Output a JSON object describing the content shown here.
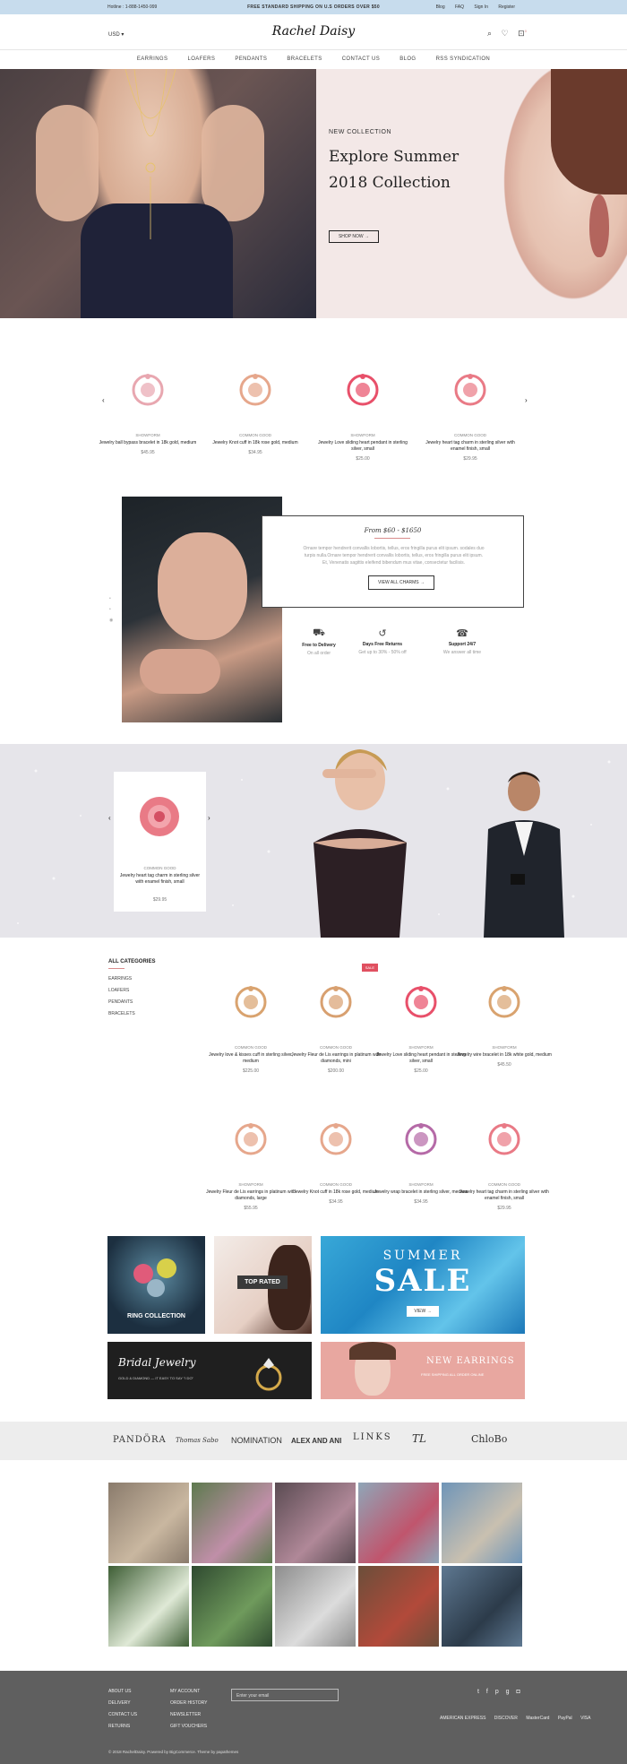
{
  "topbar": {
    "hotline": "Hotline : 1-888-1450-999",
    "shipping": "FREE STANDARD SHIPPING ON U.S ORDERS OVER $50",
    "links": [
      "Blog",
      "FAQ",
      "Sign In",
      "Register"
    ]
  },
  "header": {
    "currency": "USD ▾",
    "logo": "Rachel Daisy",
    "cart_count": "0"
  },
  "nav": [
    "EARRINGS",
    "LOAFERS",
    "PENDANTS",
    "BRACELETS",
    "CONTACT US",
    "BLOG",
    "RSS SYNDICATION"
  ],
  "hero": {
    "tag": "NEW COLLECTION",
    "title": "Explore Summer 2018 Collection",
    "button": "SHOP NOW →"
  },
  "carousel": [
    {
      "cat": "SHOWFORM",
      "name": "Jewelry ball bypass bracelet in 18k gold, medium",
      "price": "$45.95",
      "color": "#e8a7b0"
    },
    {
      "cat": "COMMON GOOD",
      "name": "Jewelry Knot cuff in 18k rose gold, medium",
      "price": "$34.95",
      "color": "#e6a78c"
    },
    {
      "cat": "SHOWFORM",
      "name": "Jewelry Love sliding heart pendant in sterling silver, small",
      "price": "$25.00",
      "color": "#e8506a"
    },
    {
      "cat": "COMMON GOOD",
      "name": "Jewelry heart tag charm in sterling silver with enamel finish, small",
      "price": "$29.95",
      "color": "#e97a86"
    }
  ],
  "feature": {
    "price": "From $60 - $1650",
    "desc": "Ornare tempor hendrerit convallis lobortis, tellus, eros fringilla purus elit ipsum. sodales duo turpis nulla.Ornare tempor hendrerit convallis lobortis, tellus, eros fringilla purus elit ipsum. Et, Venenatis sagittis eleifend bibendum mus vitae, consectetur facilisis.",
    "button": "VIEW ALL CHARMS →"
  },
  "perks": [
    {
      "icon": "truck-icon",
      "glyph": "⛟",
      "title": "Free to Delivery",
      "sub": "On all order"
    },
    {
      "icon": "returns-icon",
      "glyph": "↺",
      "title": "Days Free Returns",
      "sub": "Get up to 30% - 50% off"
    },
    {
      "icon": "support-icon",
      "glyph": "☎",
      "title": "Support 24/7",
      "sub": "We answer all time"
    }
  ],
  "promo_card": {
    "cat": "COMMON GOOD",
    "name": "Jewelry heart tag charm in sterling silver with enamel finish, small",
    "price": "$29.95"
  },
  "sidebar": {
    "title": "ALL CATEGORIES",
    "items": [
      "EARRINGS",
      "LOAFERS",
      "PENDANTS",
      "BRACELETS"
    ]
  },
  "grid": [
    {
      "cat": "COMMON GOOD",
      "name": "Jewelry love & kisses cuff in sterling silver, medium",
      "price": "$225.00",
      "color": "#d9a36f",
      "badge": ""
    },
    {
      "cat": "COMMON GOOD",
      "name": "Jewelry Fleur de Lis earrings in platinum with diamonds, mini",
      "price": "$200.00",
      "color": "#d8a070",
      "badge": "SALE"
    },
    {
      "cat": "SHOWFORM",
      "name": "Jewelry Love sliding heart pendant in sterling silver, small",
      "price": "$25.00",
      "color": "#e8506a",
      "badge": ""
    },
    {
      "cat": "SHOWFORM",
      "name": "Jewelry wire bracelet in 18k white gold, medium",
      "price": "$45.50",
      "color": "#d9a36f",
      "badge": ""
    },
    {
      "cat": "SHOWFORM",
      "name": "Jewelry Fleur de Lis earrings in platinum with diamonds, large",
      "price": "$55.95",
      "color": "#e6a78c",
      "badge": ""
    },
    {
      "cat": "COMMON GOOD",
      "name": "Jewelry Knot cuff in 18k rose gold, medium",
      "price": "$34.95",
      "color": "#e6a78c",
      "badge": ""
    },
    {
      "cat": "SHOWFORM",
      "name": "Jewelry wrap bracelet in sterling silver, medium",
      "price": "$34.95",
      "color": "#b56aa7",
      "badge": ""
    },
    {
      "cat": "COMMON GOOD",
      "name": "Jewelry heart tag charm in sterling silver with enamel finish, small",
      "price": "$29.95",
      "color": "#e97a86",
      "badge": ""
    }
  ],
  "tiles": {
    "ring": "RING COLLECTION",
    "top": "TOP RATED",
    "summer": "SUMMER",
    "sale": "SALE",
    "view": "VIEW →",
    "bridal": "Bridal Jewelry",
    "bridal_sub": "GOLD & DIAMOND — IT EASY TO SAY \"I DO\"",
    "earrings": "NEW EARRINGS",
    "earrings_sub": "FREE SHIPPING ALL ORDER ONLINE"
  },
  "brands": [
    "PANDÖRA",
    "Thomas Sabo",
    "NOMINATION",
    "ALEX AND ANI",
    "LINKS",
    "TL",
    "ChloBo"
  ],
  "footer": {
    "col1": [
      "ABOUT US",
      "DELIVERY",
      "CONTACT US",
      "RETURNS"
    ],
    "col2": [
      "MY ACCOUNT",
      "ORDER HISTORY",
      "NEWSLETTER",
      "GIFT VOUCHERS"
    ],
    "email_placeholder": "Enter your email",
    "pay": [
      "AMERICAN EXPRESS",
      "DISCOVER",
      "MasterCard",
      "PayPal",
      "VISA"
    ],
    "copyright": "© 2018 RachelDaisy. Powered by BigCommerce. Theme by papathemes"
  }
}
